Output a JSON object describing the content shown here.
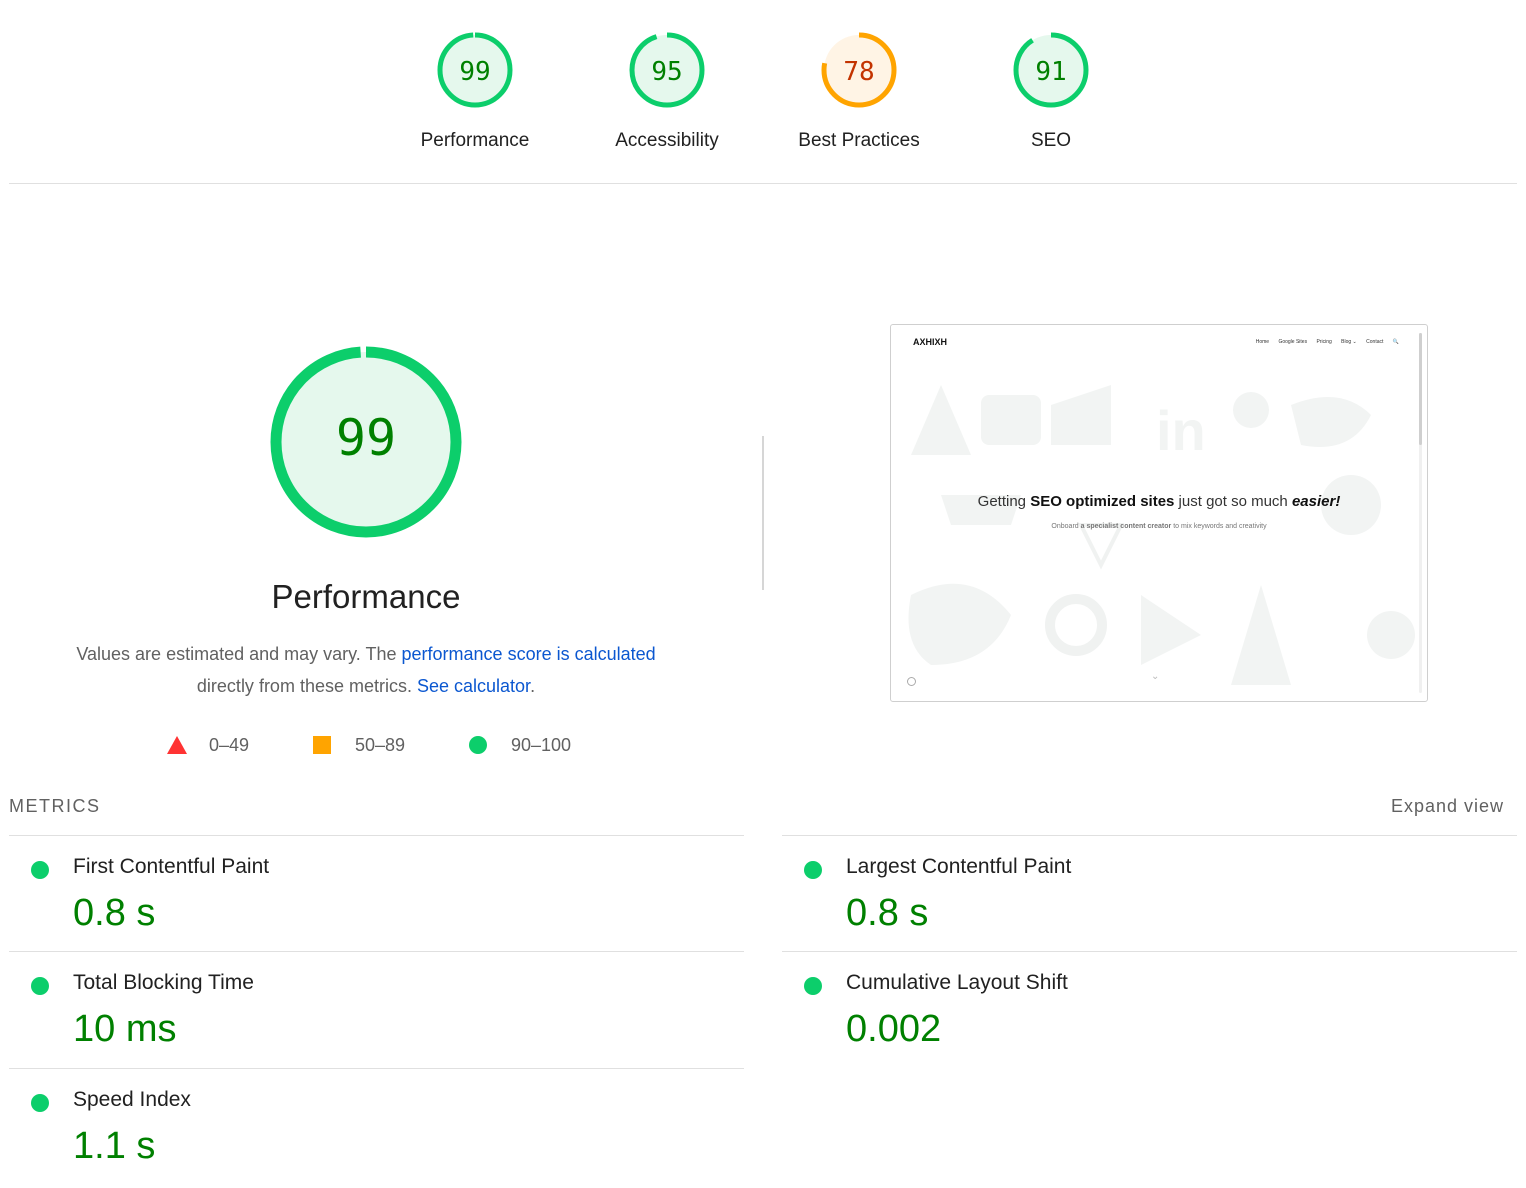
{
  "categories": [
    {
      "score": "99",
      "label": "Performance",
      "value": 0.99,
      "status": "pass"
    },
    {
      "score": "95",
      "label": "Accessibility",
      "value": 0.95,
      "status": "pass"
    },
    {
      "score": "78",
      "label": "Best Practices",
      "value": 0.78,
      "status": "average"
    },
    {
      "score": "91",
      "label": "SEO",
      "value": 0.91,
      "status": "pass"
    }
  ],
  "colors": {
    "pass": "#0cce6b",
    "pass_fill": "#e5f8ed",
    "pass_text": "#008000",
    "average": "#ffa400",
    "average_fill": "#fff4e5",
    "average_text": "#c33300",
    "fail": "#ff4e42",
    "link": "#0b57d0"
  },
  "main": {
    "score": "99",
    "value": 0.99,
    "title": "Performance",
    "desc_text_1": "Values are estimated and may vary. The ",
    "desc_link_1": "performance score is calculated",
    "desc_text_2": "directly from these metrics. ",
    "desc_link_2": "See calculator",
    "desc_text_3": "."
  },
  "legend": {
    "fail": "0–49",
    "average": "50–89",
    "pass": "90–100"
  },
  "screenshot": {
    "logo": "AXHIXH",
    "nav": [
      "Home",
      "Google Sites",
      "Pricing",
      "Blog ⌄",
      "Contact",
      "🔍"
    ],
    "headline_1": "Getting ",
    "headline_bold": "SEO optimized sites",
    "headline_2": " just got so much ",
    "headline_em": "easier!",
    "sub_1": "Onboard ",
    "sub_bold": "a specialist content creator",
    "sub_2": " to mix keywords and creativity"
  },
  "metrics": {
    "header": "METRICS",
    "expand": "Expand view",
    "items": [
      {
        "name": "First Contentful Paint",
        "value": "0.8 s"
      },
      {
        "name": "Largest Contentful Paint",
        "value": "0.8 s"
      },
      {
        "name": "Total Blocking Time",
        "value": "10 ms"
      },
      {
        "name": "Cumulative Layout Shift",
        "value": "0.002"
      },
      {
        "name": "Speed Index",
        "value": "1.1 s"
      }
    ]
  }
}
